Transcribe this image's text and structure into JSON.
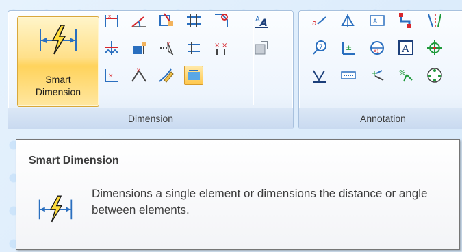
{
  "ribbon": {
    "groups": [
      {
        "label": "Dimension",
        "big_button": {
          "label_line1": "Smart",
          "label_line2": "Dimension",
          "icon": "smart-dimension-icon"
        },
        "tools": [
          "distance-between-icon",
          "angle-between-icon",
          "coordinate-dimension-icon",
          "stack-dimension-icon",
          "chamfer-dimension-icon",
          "symmetric-diameter-icon",
          "auto-dimension-icon",
          "attach-dimension-icon",
          "dimension-axis-icon",
          "ordinate-icon",
          "angular-coordinate-icon",
          "angle-icon",
          "copy-attributes-icon",
          "dimension-style-icon",
          "format-text-icon"
        ],
        "extra_tools": [
          "text-style-icon",
          "retrieve-dimensions-icon"
        ]
      },
      {
        "label": "Annotation",
        "tools": [
          "leader-icon",
          "datum-frame-icon",
          "feature-control-frame-icon",
          "weld-symbol-icon",
          "centerline-icon",
          "balloon-icon",
          "datum-target-icon",
          "surface-texture-icon",
          "text-box-icon",
          "center-mark-icon",
          "edge-condition-icon",
          "callout-icon",
          "connector-icon",
          "bolt-hole-icon",
          "bolt-circle-icon"
        ]
      }
    ]
  },
  "tooltip": {
    "title": "Smart Dimension",
    "description": "Dimensions a single element or dimensions the distance or angle between elements.",
    "icon": "smart-dimension-icon"
  },
  "colors": {
    "accent": "#ffd35c",
    "ribbon_border": "#a8c1de",
    "icon_blue": "#2a6fbf",
    "icon_red": "#d8262c",
    "icon_green": "#1f9a3a"
  }
}
